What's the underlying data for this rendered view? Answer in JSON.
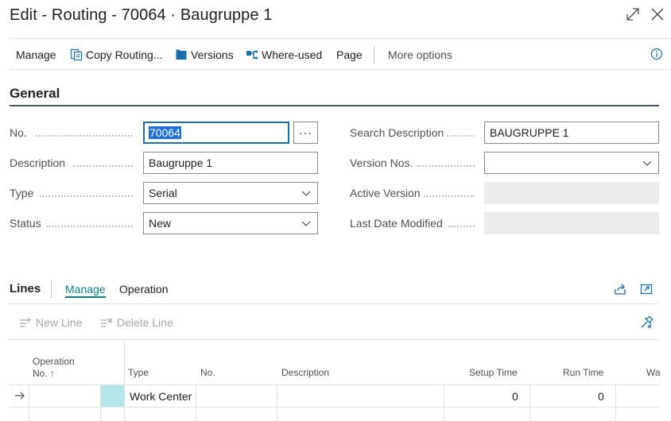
{
  "window": {
    "title": "Edit - Routing - 70064 · Baugruppe 1",
    "expand_icon": "expand-icon",
    "close_icon": "close-icon"
  },
  "actionbar": {
    "manage": "Manage",
    "copy_routing": "Copy Routing...",
    "versions": "Versions",
    "where_used": "Where-used",
    "page": "Page",
    "more_options": "More options"
  },
  "general": {
    "title": "General",
    "fields": {
      "no": {
        "label": "No.",
        "value": "70064"
      },
      "description": {
        "label": "Description",
        "value": "Baugruppe 1"
      },
      "type": {
        "label": "Type",
        "value": "Serial"
      },
      "status": {
        "label": "Status",
        "value": "New"
      },
      "search_description": {
        "label": "Search Description",
        "value": "BAUGRUPPE 1"
      },
      "version_nos": {
        "label": "Version Nos.",
        "value": ""
      },
      "active_version": {
        "label": "Active Version",
        "value": ""
      },
      "last_date_modified": {
        "label": "Last Date Modified",
        "value": ""
      }
    },
    "lookup_label": "···"
  },
  "lines": {
    "title": "Lines",
    "tabs": {
      "manage": "Manage",
      "operation": "Operation"
    },
    "actions": {
      "new_line": "New Line",
      "delete_line": "Delete Line"
    },
    "columns": {
      "operation_no_line1": "Operation",
      "operation_no_line2": "No. ↑",
      "type": "Type",
      "no": "No.",
      "description": "Description",
      "setup_time": "Setup Time",
      "run_time": "Run Time",
      "wait": "Wa"
    },
    "rows": [
      {
        "type": "Work Center",
        "no": "",
        "description": "",
        "setup_time": "0",
        "run_time": "0"
      }
    ]
  },
  "colors": {
    "accent": "#0a7d84",
    "selection": "#1e6fd9",
    "focus_border": "#1a6fa8",
    "teal_cell": "#b4e6ea"
  }
}
